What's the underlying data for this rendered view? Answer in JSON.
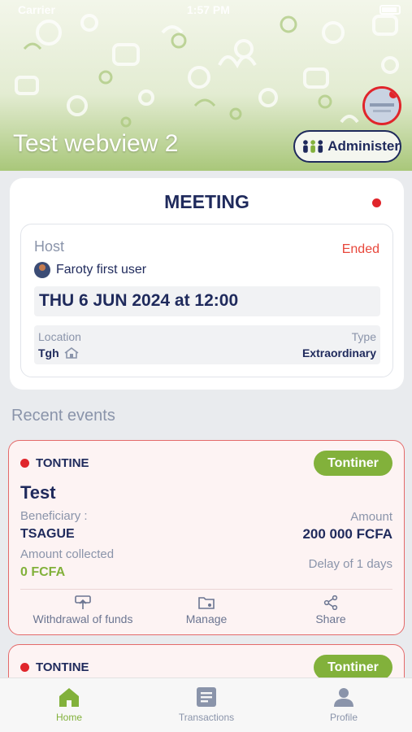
{
  "status_bar": {
    "carrier": "Carrier",
    "time": "1:57 PM"
  },
  "header": {
    "title": "Test webview 2",
    "admin_label": "Administer",
    "colors": {
      "accent": "#82b13b",
      "navy": "#1f2a5c",
      "alert": "#e0252b"
    }
  },
  "meeting": {
    "title": "MEETING",
    "host_label": "Host",
    "status": "Ended",
    "host_name": "Faroty first user",
    "datetime": "THU 6 JUN 2024 at 12:00",
    "location_label": "Location",
    "location_value": "Tgh",
    "type_label": "Type",
    "type_value": "Extraordinary"
  },
  "recent": {
    "title": "Recent events",
    "events": [
      {
        "type": "TONTINE",
        "role": "Tontiner",
        "name": "Test",
        "beneficiary_label": "Beneficiary :",
        "beneficiary_value": "TSAGUE",
        "amount_label": "Amount",
        "amount_value": "200 000 FCFA",
        "collected_label": "Amount collected",
        "collected_value": "0 FCFA",
        "delay": "Delay of 1 days",
        "actions": {
          "withdraw": "Withdrawal of funds",
          "manage": "Manage",
          "share": "Share"
        }
      },
      {
        "type": "TONTINE",
        "role": "Tontiner"
      }
    ]
  },
  "tabbar": {
    "home": "Home",
    "transactions": "Transactions",
    "profile": "Profile"
  }
}
